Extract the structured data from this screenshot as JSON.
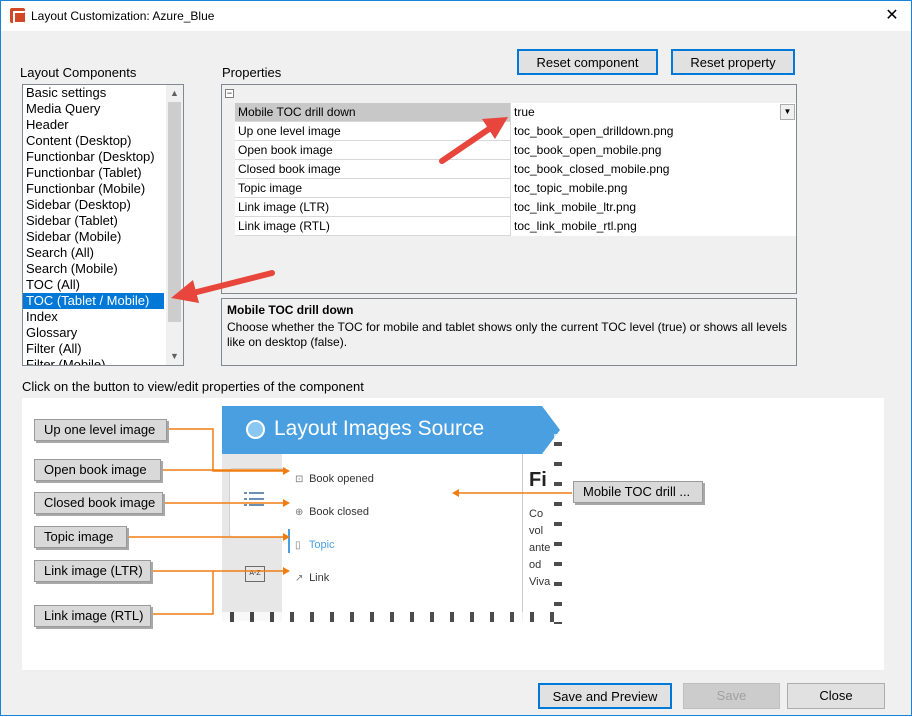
{
  "window": {
    "title": "Layout Customization: Azure_Blue",
    "close_glyph": "✕"
  },
  "labels": {
    "layout_components": "Layout Components",
    "properties": "Properties",
    "hint": "Click on the button to view/edit properties of the component"
  },
  "toolbar": {
    "reset_component": "Reset component",
    "reset_property": "Reset property"
  },
  "components": {
    "items": [
      "Basic settings",
      "Media Query",
      "Header",
      "Content (Desktop)",
      "Functionbar (Desktop)",
      "Functionbar (Tablet)",
      "Functionbar (Mobile)",
      "Sidebar (Desktop)",
      "Sidebar (Tablet)",
      "Sidebar (Mobile)",
      "Search (All)",
      "Search (Mobile)",
      "TOC (All)",
      "TOC (Tablet / Mobile)",
      "Index",
      "Glossary",
      "Filter (All)",
      "Filter (Mobile)"
    ],
    "selected": "TOC (Tablet / Mobile)"
  },
  "properties": {
    "category_toggle": "−",
    "rows": [
      {
        "name": "Mobile TOC drill down",
        "value": "true"
      },
      {
        "name": "Up one level image",
        "value": "toc_book_open_drilldown.png"
      },
      {
        "name": "Open book image",
        "value": "toc_book_open_mobile.png"
      },
      {
        "name": "Closed book image",
        "value": "toc_book_closed_mobile.png"
      },
      {
        "name": "Topic image",
        "value": "toc_topic_mobile.png"
      },
      {
        "name": "Link image (LTR)",
        "value": "toc_link_mobile_ltr.png"
      },
      {
        "name": "Link image (RTL)",
        "value": "toc_link_mobile_rtl.png"
      }
    ],
    "dropdown_glyph": "▼"
  },
  "description": {
    "title": "Mobile TOC drill down",
    "text": "Choose whether the TOC for mobile and tablet shows only the current TOC level (true) or shows all levels like on desktop (false)."
  },
  "preview": {
    "buttons": {
      "up_one_level": "Up one level image",
      "open_book": "Open book image",
      "closed_book": "Closed book image",
      "topic": "Topic image",
      "link_ltr": "Link image (LTR)",
      "link_rtl": "Link image (RTL)",
      "mobile_toc": "Mobile TOC drill ..."
    },
    "mock": {
      "title": "Layout Images Source",
      "toc": [
        "Book opened",
        "Book closed",
        "Topic",
        "Link"
      ],
      "content_heading": "Fi",
      "content_lines": [
        "Co",
        "vol",
        "ante",
        "od",
        "Viva"
      ],
      "az": "A-Z"
    }
  },
  "footer": {
    "save_preview": "Save and Preview",
    "save": "Save",
    "close": "Close"
  },
  "colors": {
    "accent": "#0078d7",
    "arrow": "#e8453c",
    "connector": "#f07d12",
    "mock_header": "#4a9fe0"
  }
}
